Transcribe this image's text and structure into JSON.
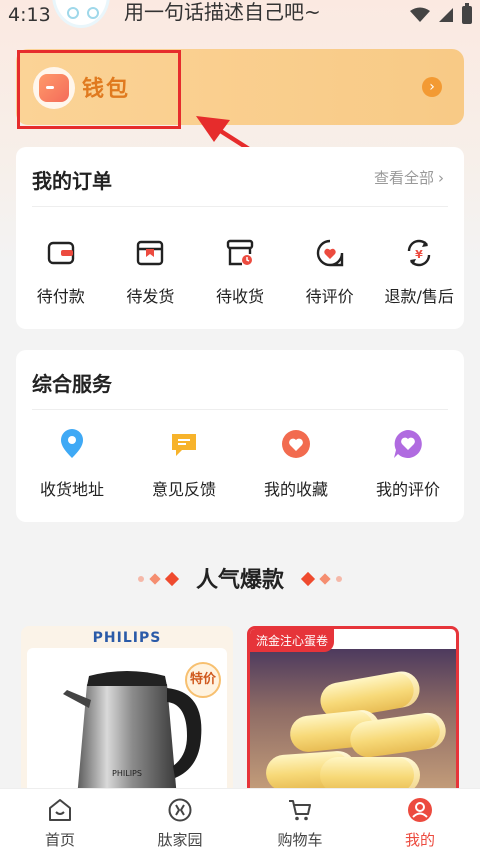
{
  "status_bar": {
    "time": "4:13",
    "subtitle": "用一句话描述自己吧~"
  },
  "wallet": {
    "title": "钱包",
    "arrow": "›"
  },
  "orders": {
    "title": "我的订单",
    "view_all": "查看全部",
    "chevron": "›",
    "items": [
      {
        "label": "待付款",
        "icon": "wallet-icon"
      },
      {
        "label": "待发货",
        "icon": "package-icon"
      },
      {
        "label": "待收货",
        "icon": "delivery-box-icon"
      },
      {
        "label": "待评价",
        "icon": "review-icon"
      },
      {
        "label": "退款/售后",
        "icon": "refund-icon"
      }
    ]
  },
  "services": {
    "title": "综合服务",
    "items": [
      {
        "label": "收货地址",
        "icon": "location-pin-icon",
        "color": "#3fa9f5"
      },
      {
        "label": "意见反馈",
        "icon": "feedback-icon",
        "color": "#f7b32b"
      },
      {
        "label": "我的收藏",
        "icon": "heart-icon",
        "color": "#f26b4f"
      },
      {
        "label": "我的评价",
        "icon": "review-heart-icon",
        "color": "#b06be0"
      }
    ]
  },
  "popular": {
    "title": "人气爆款",
    "products": [
      {
        "brand": "PHILIPS",
        "badge": "特价"
      },
      {
        "tag": "流金注心蛋卷"
      }
    ]
  },
  "bottom_nav": {
    "items": [
      {
        "label": "首页",
        "icon": "home-icon"
      },
      {
        "label": "肽家园",
        "icon": "community-icon"
      },
      {
        "label": "购物车",
        "icon": "cart-icon"
      },
      {
        "label": "我的",
        "icon": "profile-icon"
      }
    ],
    "active_color": "#ec4b3f"
  }
}
